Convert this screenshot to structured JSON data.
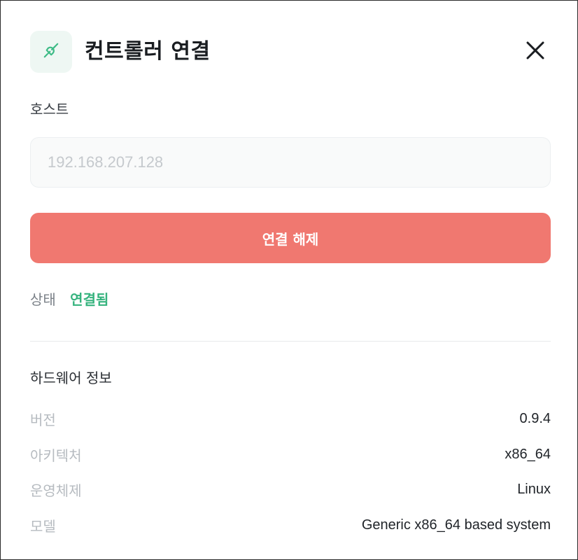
{
  "dialog": {
    "title": "컨트롤러 연결",
    "icon": "plug-icon",
    "close_icon": "close-icon"
  },
  "host": {
    "label": "호스트",
    "value": "",
    "placeholder": "192.168.207.128"
  },
  "actions": {
    "disconnect_label": "연결 해제"
  },
  "status": {
    "label": "상태",
    "value": "연결됨"
  },
  "hardware": {
    "title": "하드웨어 정보",
    "rows": [
      {
        "key": "버전",
        "value": "0.9.4"
      },
      {
        "key": "아키텍처",
        "value": "x86_64"
      },
      {
        "key": "운영체제",
        "value": "Linux"
      },
      {
        "key": "모델",
        "value": "Generic x86_64 based system"
      }
    ]
  },
  "colors": {
    "accent_green": "#36b37e",
    "disconnect_red": "#f07870",
    "icon_tile_bg": "#eef7f3"
  }
}
